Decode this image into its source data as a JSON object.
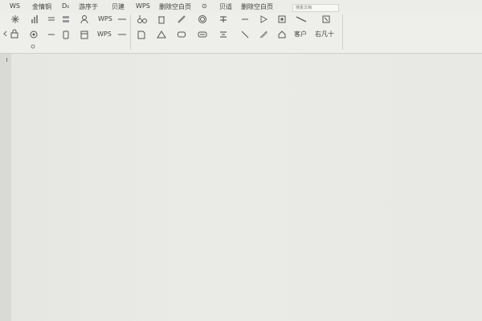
{
  "menu": {
    "items": [
      "WS",
      "金情铜",
      "D₀",
      "游序于",
      "贝建",
      "WPS",
      "删除空白页",
      "⊙",
      "贝适",
      "删除空白页"
    ]
  },
  "search": {
    "placeholder": "搜素文档"
  },
  "toolbar": {
    "wps_label_1": "WPS",
    "wps_label_2": "WPS",
    "customer_label": "客户",
    "last_label": "右凡十"
  },
  "icons": [
    "sparkle-icon",
    "chart-icon",
    "align-icon",
    "grid-icon",
    "person-icon",
    "shapes-icon",
    "trash-icon",
    "pen-icon",
    "circle-icon",
    "text-box-icon",
    "dash-icon",
    "play-icon",
    "frame-icon",
    "line-icon",
    "image-icon"
  ]
}
